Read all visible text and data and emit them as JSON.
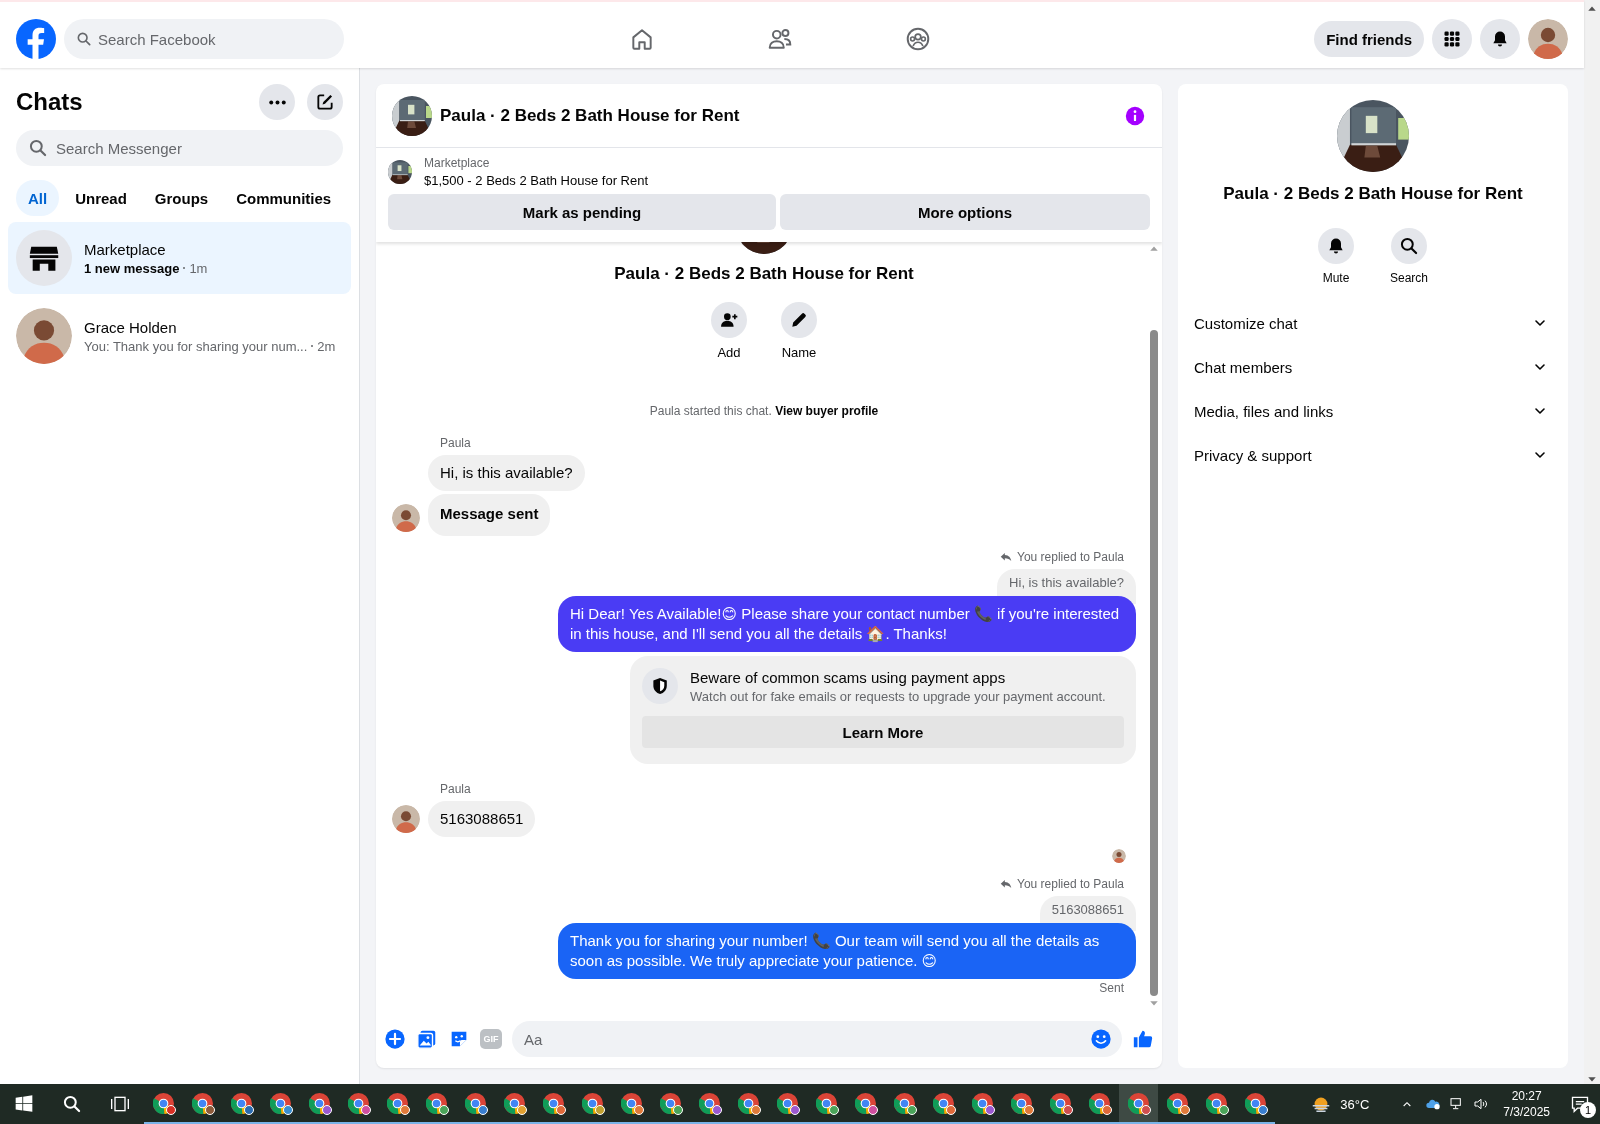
{
  "top_bar": {
    "search": {
      "placeholder": "Search Facebook"
    },
    "find_friends": "Find friends"
  },
  "chats": {
    "title": "Chats",
    "search": {
      "placeholder": "Search Messenger"
    },
    "filters": [
      {
        "label": "All",
        "selected": true
      },
      {
        "label": "Unread",
        "selected": false
      },
      {
        "label": "Groups",
        "selected": false
      },
      {
        "label": "Communities",
        "selected": false
      }
    ],
    "items": [
      {
        "name": "Marketplace",
        "preview": "1 new message",
        "time": "1m",
        "kind": "store",
        "unread": true,
        "selected": true
      },
      {
        "name": "Grace Holden",
        "preview": "You: Thank you for sharing your num...",
        "time": "2m",
        "kind": "person",
        "unread": false,
        "selected": false
      }
    ]
  },
  "conversation": {
    "title": "Paula · 2 Beds 2 Bath House for Rent",
    "listing": {
      "label": "Marketplace",
      "title": "$1,500 - 2 Beds 2 Bath House for Rent"
    },
    "actions": [
      "Mark as pending",
      "More options"
    ],
    "intro": {
      "title": "Paula · 2 Beds 2 Bath House for Rent",
      "buttons": [
        {
          "label": "Add"
        },
        {
          "label": "Name"
        }
      ]
    },
    "messages": [
      {
        "kind": "system",
        "text": "Paula started this chat.",
        "link": "View buyer profile"
      },
      {
        "kind": "incoming",
        "sender": "Paula",
        "bubbles": [
          {
            "kind": "text",
            "text": "Hi, is this available?"
          },
          {
            "kind": "event",
            "text": "Message sent"
          }
        ]
      },
      {
        "kind": "outgoing",
        "reply_label": "You replied to Paula",
        "quote": "Hi, is this available?",
        "text": "Hi Dear! Yes Available!😊 Please share your contact number 📞 if you're interested in this house, and I'll send you all the details 🏠. Thanks!",
        "color": "#4a3cf4"
      },
      {
        "kind": "notice",
        "title": "Beware of common scams using payment apps",
        "text": "Watch out for fake emails or requests to upgrade your payment account.",
        "button": "Learn More"
      },
      {
        "kind": "incoming",
        "sender": "Paula",
        "bubbles": [
          {
            "kind": "text",
            "text": "5163088651"
          }
        ]
      },
      {
        "kind": "seen"
      },
      {
        "kind": "outgoing",
        "reply_label": "You replied to Paula",
        "quote": "5163088651",
        "text": "Thank you for sharing your number! 📞 Our team will send you all the details as soon as possible. We truly appreciate your patience. 😊",
        "color": "#1a64f5"
      },
      {
        "kind": "status",
        "text": "Sent"
      }
    ],
    "composer": {
      "placeholder": "Aa",
      "gif": "GIF"
    }
  },
  "details": {
    "title": "Paula · 2 Beds 2 Bath House for Rent",
    "actions": [
      {
        "label": "Mute"
      },
      {
        "label": "Search"
      }
    ],
    "sections": [
      {
        "label": "Customize chat",
        "expanded": false
      },
      {
        "label": "Chat members",
        "expanded": false
      },
      {
        "label": "Media, files and links",
        "expanded": false
      },
      {
        "label": "Privacy & support",
        "expanded": false
      }
    ]
  },
  "taskbar": {
    "apps": [
      {
        "color": "#d93025",
        "selected": false
      },
      {
        "color": "#8d5b3a",
        "selected": false
      },
      {
        "color": "#2b6cb0",
        "selected": false
      },
      {
        "color": "#3a8fd0",
        "selected": false
      },
      {
        "color": "#9b59d0",
        "selected": false
      },
      {
        "color": "#d04fa0",
        "selected": false
      },
      {
        "color": "#e07a3a",
        "selected": false
      },
      {
        "color": "#4aa45a",
        "selected": false
      },
      {
        "color": "#3a7fd0",
        "selected": false
      },
      {
        "color": "#e0a030",
        "selected": false
      },
      {
        "color": "#e06a3a",
        "selected": false
      },
      {
        "color": "#c0a030",
        "selected": false
      },
      {
        "color": "#e07a3a",
        "selected": false
      },
      {
        "color": "#4aa45a",
        "selected": false
      },
      {
        "color": "#9b59d0",
        "selected": false
      },
      {
        "color": "#e07a3a",
        "selected": false
      },
      {
        "color": "#9b59d0",
        "selected": false
      },
      {
        "color": "#4aa45a",
        "selected": false
      },
      {
        "color": "#d04fa0",
        "selected": false
      },
      {
        "color": "#4aa45a",
        "selected": false
      },
      {
        "color": "#e06a3a",
        "selected": false
      },
      {
        "color": "#9b59d0",
        "selected": false
      },
      {
        "color": "#e07a3a",
        "selected": false
      },
      {
        "color": "#d04f4f",
        "selected": false
      },
      {
        "color": "#e06a3a",
        "selected": false
      },
      {
        "color": "#d04f4f",
        "selected": true
      },
      {
        "color": "#e07a3a",
        "selected": false
      },
      {
        "color": "#4aa45a",
        "selected": false
      },
      {
        "color": "#3a7fd0",
        "selected": false
      }
    ],
    "weather": "36°C",
    "time": "20:27",
    "date": "7/3/2025",
    "notifications": "1"
  }
}
